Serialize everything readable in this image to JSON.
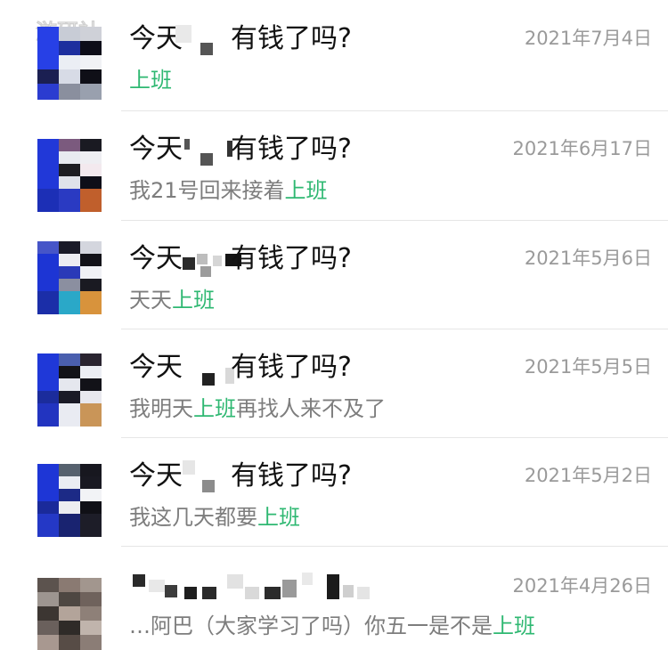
{
  "watermark": {
    "text": "游研社"
  },
  "colors": {
    "accent_green": "#2fb872",
    "date_gray": "#9a9a9a",
    "preview_gray": "#7d7d7d",
    "name_black": "#111111"
  },
  "chats": [
    {
      "name_start": "今天",
      "name_end": "有钱了吗?",
      "date": "2021年7月4日",
      "preview_before": "",
      "preview_highlight": "上班",
      "preview_after": ""
    },
    {
      "name_start": "今天",
      "name_end": "有钱了吗?",
      "date": "2021年6月17日",
      "preview_before": "我21号回来接着",
      "preview_highlight": "上班",
      "preview_after": ""
    },
    {
      "name_start": "今天",
      "name_end": "有钱了吗?",
      "date": "2021年5月6日",
      "preview_before": "天天",
      "preview_highlight": "上班",
      "preview_after": ""
    },
    {
      "name_start": "今天",
      "name_end": "有钱了吗?",
      "date": "2021年5月5日",
      "preview_before": "我明天",
      "preview_highlight": "上班",
      "preview_after": "再找人来不及了"
    },
    {
      "name_start": "今天",
      "name_end": "有钱了吗?",
      "date": "2021年5月2日",
      "preview_before": "我这几天都要",
      "preview_highlight": "上班",
      "preview_after": ""
    },
    {
      "name_start": "",
      "name_end": "",
      "date": "2021年4月26日",
      "preview_before": "…阿巴（大家学习了吗）你五一是不是",
      "preview_highlight": "上班",
      "preview_after": ""
    }
  ]
}
